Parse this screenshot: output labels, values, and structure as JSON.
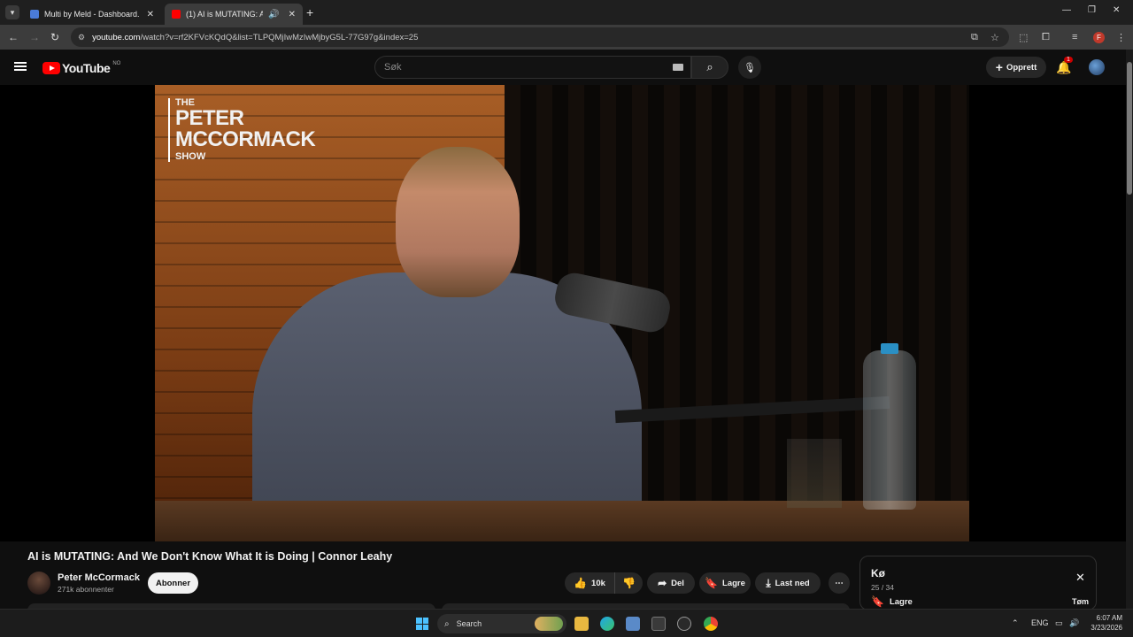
{
  "browser": {
    "tabs": [
      {
        "title": "Multi by Meld - Dashboard.",
        "favicon_color": "#4a7bd8"
      },
      {
        "title": "(1) AI is MUTATING: And We",
        "favicon_color": "#ff0000"
      }
    ],
    "url_host": "youtube.com",
    "url_path": "/watch?v=rf2KFVcKQdQ&list=TLPQMjIwMzIwMjbyG5L-77G97g&index=25",
    "profile_initial": "F"
  },
  "youtube": {
    "logo_text": "YouTube",
    "country_code": "NO",
    "search_placeholder": "Søk",
    "create_label": "Opprett",
    "notification_count": "1"
  },
  "video": {
    "overlay": {
      "line1": "THE",
      "line2": "PETER",
      "line3": "MCCORMACK",
      "line4": "SHOW"
    },
    "title": "AI is MUTATING: And We Don't Know What It is Doing | Connor Leahy",
    "channel_name": "Peter McCormack",
    "subscribers": "271k abonnenter",
    "subscribe_label": "Abonner",
    "likes": "10k",
    "share_label": "Del",
    "save_label": "Lagre",
    "download_label": "Last ned"
  },
  "queue": {
    "title": "Kø",
    "position": "25 / 34",
    "save_label": "Lagre",
    "clear_label": "Tøm"
  },
  "taskbar": {
    "search_label": "Search",
    "language": "ENG",
    "time": "6:07 AM",
    "date": "3/23/2026"
  },
  "icons": {
    "tab_list": "chevron-down-icon",
    "close": "close-icon",
    "back": "back-arrow-icon",
    "forward": "forward-arrow-icon",
    "reload": "reload-icon",
    "like": "thumbs-up-icon",
    "dislike": "thumbs-down-icon",
    "share": "share-icon",
    "save": "bookmark-icon",
    "download": "download-icon"
  }
}
